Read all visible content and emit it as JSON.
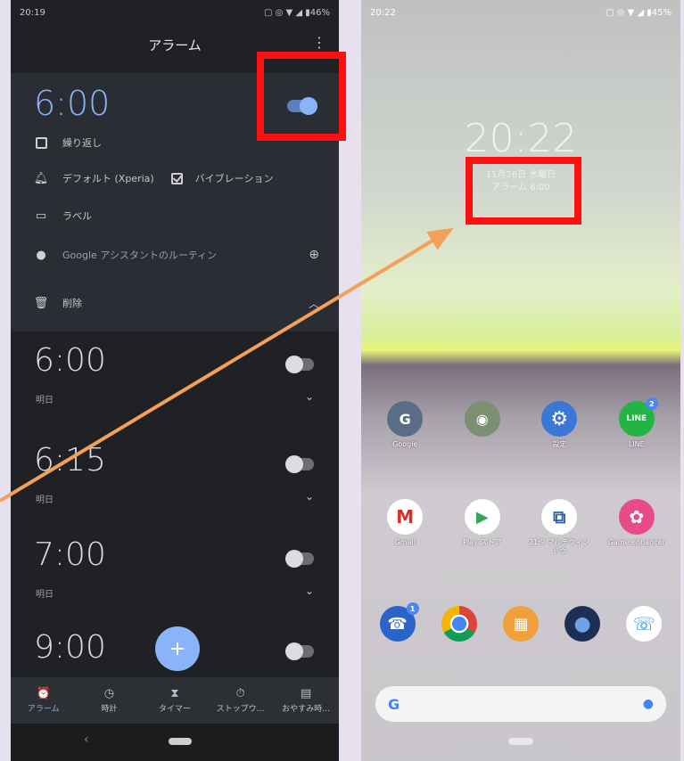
{
  "left": {
    "status": {
      "time": "20:19",
      "indicators": "▢ ◎ ▼ ◢ ▮46%"
    },
    "app_title": "アラーム",
    "overflow": "⋮",
    "expanded_alarm": {
      "time": "6:00",
      "repeat_label": "繰り返し",
      "sound_label": "デフォルト (Xperia)",
      "vibration_label": "バイブレーション",
      "label_label": "ラベル",
      "google_label": "Google アシスタントのルーティン",
      "delete_label": "削除",
      "on": true
    },
    "alarms": [
      {
        "time": "6:00",
        "sub": "明日",
        "on": false
      },
      {
        "time": "6:15",
        "sub": "明日",
        "on": false
      },
      {
        "time": "7:00",
        "sub": "明日",
        "on": false
      },
      {
        "time": "9:00",
        "sub": "",
        "on": false
      }
    ],
    "fab_label": "+",
    "nav": [
      {
        "label": "アラーム",
        "icon": "⏰"
      },
      {
        "label": "時計",
        "icon": "◷"
      },
      {
        "label": "タイマー",
        "icon": "⧗"
      },
      {
        "label": "ストップウ…",
        "icon": "⏱"
      },
      {
        "label": "おやすみ時…",
        "icon": "▤"
      }
    ]
  },
  "right": {
    "status": {
      "time": "20:22",
      "indicators": "▢ ◎ ▼ ◢ ▮45%"
    },
    "clock": "20:22",
    "date_line1": "11月26日 水曜日",
    "date_line2": "アラーム 6:00",
    "row1": [
      {
        "label": "Google",
        "bg": "#5a6d86",
        "glyph": "G"
      },
      {
        "label": "",
        "bg": "#7b8f71",
        "glyph": "◉"
      },
      {
        "label": "設定",
        "bg": "#3b78d6",
        "glyph": "⚙"
      },
      {
        "label": "LINE",
        "bg": "#22b545",
        "glyph": "LINE",
        "badge": "2"
      }
    ],
    "row2": [
      {
        "label": "Gmail",
        "bg": "#ffffff",
        "glyph": "M",
        "fg": "#d93025"
      },
      {
        "label": "Play ストア",
        "bg": "#ffffff",
        "glyph": "▶",
        "fg": "#34a853"
      },
      {
        "label": "21:9 マルチウィンドウ",
        "bg": "#ffffff",
        "glyph": "⧉",
        "fg": "#2d5fa8"
      },
      {
        "label": "Game enhancer",
        "bg": "#e84b8a",
        "glyph": "✿"
      }
    ],
    "dock": [
      {
        "label": "",
        "bg": "#2b63c9",
        "glyph": "☎",
        "badge": "1"
      },
      {
        "label": "",
        "bg": "#e8a33a",
        "glyph": "◎"
      },
      {
        "label": "",
        "bg": "#f0a03a",
        "glyph": "▦"
      },
      {
        "label": "",
        "bg": "#1e2f55",
        "glyph": "●"
      },
      {
        "label": "",
        "bg": "#ffffff",
        "glyph": "☏",
        "fg": "#1f8bd9"
      }
    ],
    "search_g": "G",
    "search_mic": "🎤"
  }
}
